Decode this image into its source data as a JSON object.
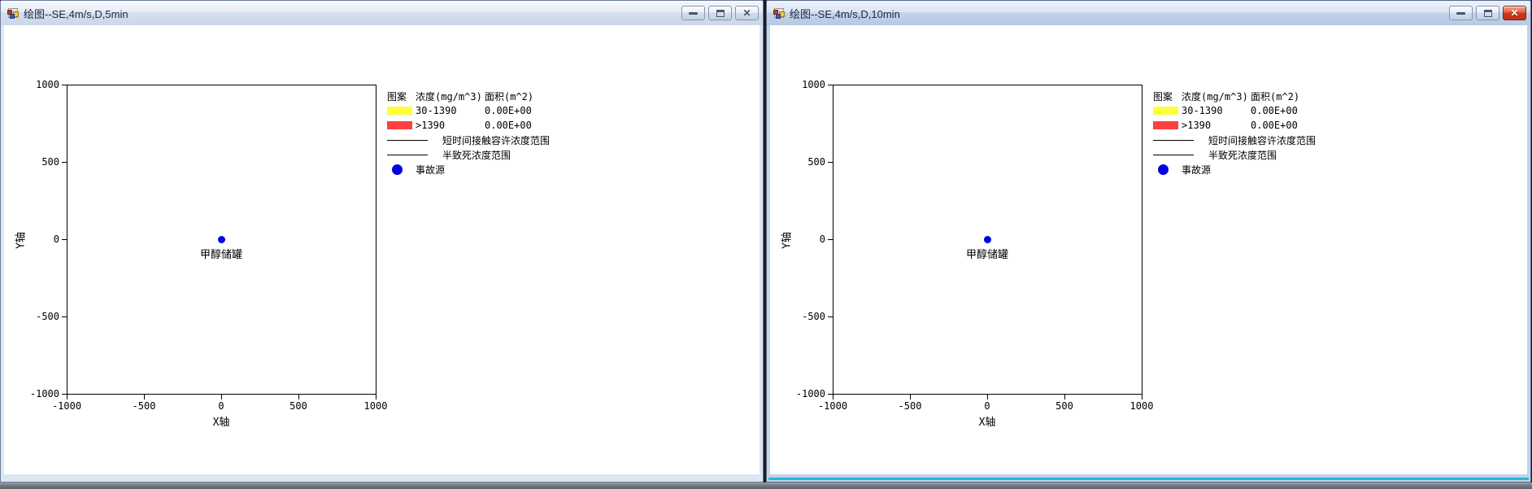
{
  "windows": [
    {
      "title": "绘图--SE,4m/s,D,5min",
      "active": false
    },
    {
      "title": "绘图--SE,4m/s,D,10min",
      "active": true
    }
  ],
  "colors": {
    "legend_yellow": "#ffff3a",
    "legend_red": "#fb4141",
    "source_blue": "#0000e0",
    "active_close_red": "#cf3a1e",
    "active_window_accent": "#2ab6d9",
    "title_text": "#1a2942"
  },
  "chart_data": [
    {
      "type": "scatter",
      "title": "",
      "xlabel": "X轴",
      "ylabel": "Y轴",
      "xlim": [
        -1000,
        1000
      ],
      "ylim": [
        -1000,
        1000
      ],
      "xticks": [
        "-1000",
        "-500",
        "0",
        "500",
        "1000"
      ],
      "yticks": [
        "1000",
        "500",
        "0",
        "-500",
        "-1000"
      ],
      "grid": false,
      "legend_position": "outside-top-right",
      "points": [
        {
          "x": 0,
          "y": 0,
          "label": "甲醇储罐",
          "marker": "circle",
          "color": "#0000e0"
        }
      ],
      "legend": {
        "header": {
          "pattern": "图案",
          "concentration": "浓度(mg/m^3)",
          "area": "面积(m^2)"
        },
        "rows": [
          {
            "type": "swatch",
            "color": "#ffff3a",
            "label": "30-1390",
            "value": "0.00E+00"
          },
          {
            "type": "swatch",
            "color": "#fb4141",
            "label": ">1390",
            "value": "0.00E+00"
          },
          {
            "type": "line",
            "color": "#000000",
            "label": "短时间接触容许浓度范围",
            "value": ""
          },
          {
            "type": "line",
            "color": "#000000",
            "label": "半致死浓度范围",
            "value": ""
          },
          {
            "type": "dot",
            "color": "#0000e0",
            "label": "事故源",
            "value": ""
          }
        ]
      }
    },
    {
      "type": "scatter",
      "title": "",
      "xlabel": "X轴",
      "ylabel": "Y轴",
      "xlim": [
        -1000,
        1000
      ],
      "ylim": [
        -1000,
        1000
      ],
      "xticks": [
        "-1000",
        "-500",
        "0",
        "500",
        "1000"
      ],
      "yticks": [
        "1000",
        "500",
        "0",
        "-500",
        "-1000"
      ],
      "grid": false,
      "legend_position": "outside-top-right",
      "points": [
        {
          "x": 0,
          "y": 0,
          "label": "甲醇储罐",
          "marker": "circle",
          "color": "#0000e0"
        }
      ],
      "legend": {
        "header": {
          "pattern": "图案",
          "concentration": "浓度(mg/m^3)",
          "area": "面积(m^2)"
        },
        "rows": [
          {
            "type": "swatch",
            "color": "#ffff3a",
            "label": "30-1390",
            "value": "0.00E+00"
          },
          {
            "type": "swatch",
            "color": "#fb4141",
            "label": ">1390",
            "value": "0.00E+00"
          },
          {
            "type": "line",
            "color": "#000000",
            "label": "短时间接触容许浓度范围",
            "value": ""
          },
          {
            "type": "line",
            "color": "#000000",
            "label": "半致死浓度范围",
            "value": ""
          },
          {
            "type": "dot",
            "color": "#0000e0",
            "label": "事故源",
            "value": ""
          }
        ]
      }
    }
  ]
}
